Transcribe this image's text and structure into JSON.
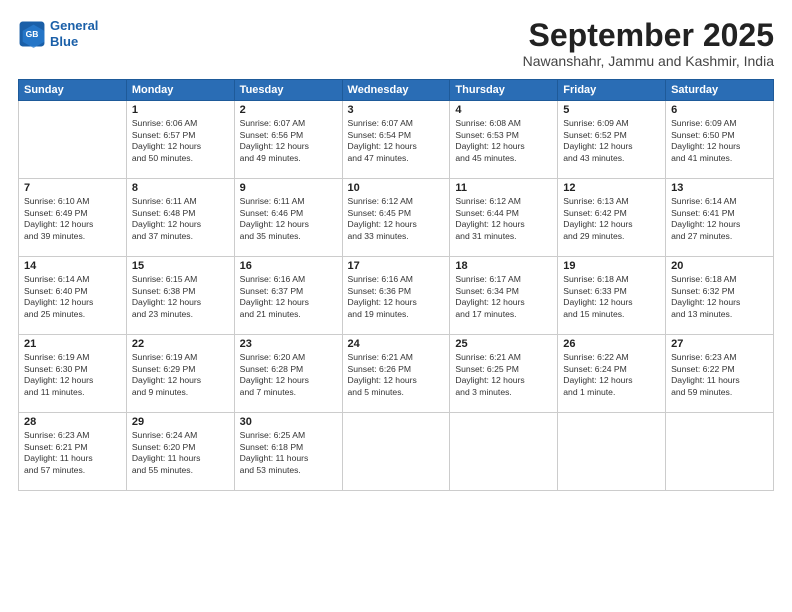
{
  "logo": {
    "line1": "General",
    "line2": "Blue"
  },
  "title": "September 2025",
  "subtitle": "Nawanshahr, Jammu and Kashmir, India",
  "weekdays": [
    "Sunday",
    "Monday",
    "Tuesday",
    "Wednesday",
    "Thursday",
    "Friday",
    "Saturday"
  ],
  "weeks": [
    [
      {
        "day": "",
        "info": ""
      },
      {
        "day": "1",
        "info": "Sunrise: 6:06 AM\nSunset: 6:57 PM\nDaylight: 12 hours\nand 50 minutes."
      },
      {
        "day": "2",
        "info": "Sunrise: 6:07 AM\nSunset: 6:56 PM\nDaylight: 12 hours\nand 49 minutes."
      },
      {
        "day": "3",
        "info": "Sunrise: 6:07 AM\nSunset: 6:54 PM\nDaylight: 12 hours\nand 47 minutes."
      },
      {
        "day": "4",
        "info": "Sunrise: 6:08 AM\nSunset: 6:53 PM\nDaylight: 12 hours\nand 45 minutes."
      },
      {
        "day": "5",
        "info": "Sunrise: 6:09 AM\nSunset: 6:52 PM\nDaylight: 12 hours\nand 43 minutes."
      },
      {
        "day": "6",
        "info": "Sunrise: 6:09 AM\nSunset: 6:50 PM\nDaylight: 12 hours\nand 41 minutes."
      }
    ],
    [
      {
        "day": "7",
        "info": "Sunrise: 6:10 AM\nSunset: 6:49 PM\nDaylight: 12 hours\nand 39 minutes."
      },
      {
        "day": "8",
        "info": "Sunrise: 6:11 AM\nSunset: 6:48 PM\nDaylight: 12 hours\nand 37 minutes."
      },
      {
        "day": "9",
        "info": "Sunrise: 6:11 AM\nSunset: 6:46 PM\nDaylight: 12 hours\nand 35 minutes."
      },
      {
        "day": "10",
        "info": "Sunrise: 6:12 AM\nSunset: 6:45 PM\nDaylight: 12 hours\nand 33 minutes."
      },
      {
        "day": "11",
        "info": "Sunrise: 6:12 AM\nSunset: 6:44 PM\nDaylight: 12 hours\nand 31 minutes."
      },
      {
        "day": "12",
        "info": "Sunrise: 6:13 AM\nSunset: 6:42 PM\nDaylight: 12 hours\nand 29 minutes."
      },
      {
        "day": "13",
        "info": "Sunrise: 6:14 AM\nSunset: 6:41 PM\nDaylight: 12 hours\nand 27 minutes."
      }
    ],
    [
      {
        "day": "14",
        "info": "Sunrise: 6:14 AM\nSunset: 6:40 PM\nDaylight: 12 hours\nand 25 minutes."
      },
      {
        "day": "15",
        "info": "Sunrise: 6:15 AM\nSunset: 6:38 PM\nDaylight: 12 hours\nand 23 minutes."
      },
      {
        "day": "16",
        "info": "Sunrise: 6:16 AM\nSunset: 6:37 PM\nDaylight: 12 hours\nand 21 minutes."
      },
      {
        "day": "17",
        "info": "Sunrise: 6:16 AM\nSunset: 6:36 PM\nDaylight: 12 hours\nand 19 minutes."
      },
      {
        "day": "18",
        "info": "Sunrise: 6:17 AM\nSunset: 6:34 PM\nDaylight: 12 hours\nand 17 minutes."
      },
      {
        "day": "19",
        "info": "Sunrise: 6:18 AM\nSunset: 6:33 PM\nDaylight: 12 hours\nand 15 minutes."
      },
      {
        "day": "20",
        "info": "Sunrise: 6:18 AM\nSunset: 6:32 PM\nDaylight: 12 hours\nand 13 minutes."
      }
    ],
    [
      {
        "day": "21",
        "info": "Sunrise: 6:19 AM\nSunset: 6:30 PM\nDaylight: 12 hours\nand 11 minutes."
      },
      {
        "day": "22",
        "info": "Sunrise: 6:19 AM\nSunset: 6:29 PM\nDaylight: 12 hours\nand 9 minutes."
      },
      {
        "day": "23",
        "info": "Sunrise: 6:20 AM\nSunset: 6:28 PM\nDaylight: 12 hours\nand 7 minutes."
      },
      {
        "day": "24",
        "info": "Sunrise: 6:21 AM\nSunset: 6:26 PM\nDaylight: 12 hours\nand 5 minutes."
      },
      {
        "day": "25",
        "info": "Sunrise: 6:21 AM\nSunset: 6:25 PM\nDaylight: 12 hours\nand 3 minutes."
      },
      {
        "day": "26",
        "info": "Sunrise: 6:22 AM\nSunset: 6:24 PM\nDaylight: 12 hours\nand 1 minute."
      },
      {
        "day": "27",
        "info": "Sunrise: 6:23 AM\nSunset: 6:22 PM\nDaylight: 11 hours\nand 59 minutes."
      }
    ],
    [
      {
        "day": "28",
        "info": "Sunrise: 6:23 AM\nSunset: 6:21 PM\nDaylight: 11 hours\nand 57 minutes."
      },
      {
        "day": "29",
        "info": "Sunrise: 6:24 AM\nSunset: 6:20 PM\nDaylight: 11 hours\nand 55 minutes."
      },
      {
        "day": "30",
        "info": "Sunrise: 6:25 AM\nSunset: 6:18 PM\nDaylight: 11 hours\nand 53 minutes."
      },
      {
        "day": "",
        "info": ""
      },
      {
        "day": "",
        "info": ""
      },
      {
        "day": "",
        "info": ""
      },
      {
        "day": "",
        "info": ""
      }
    ]
  ]
}
